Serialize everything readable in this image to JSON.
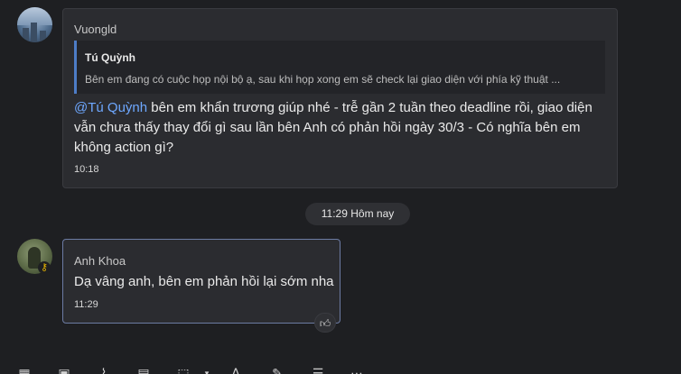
{
  "messages": [
    {
      "sender": "Vuongld",
      "quote": {
        "author": "Tú Quỳnh",
        "text": "Bên em đang có cuộc họp nội bộ ạ, sau khi họp xong em sẽ check lại giao diện với phía kỹ thuật ..."
      },
      "mention": "@Tú Quỳnh",
      "text": " bên em khẩn trương giúp nhé - trễ gần 2 tuần theo deadline rồi, giao diện vẫn chưa thấy thay đổi gì sau lần bên Anh có phản hồi ngày 30/3 - Có nghĩa bên em không action gì?",
      "time": "10:18"
    },
    {
      "sender": "Anh Khoa",
      "text": "Dạ vâng anh, bên em phản hồi lại sớm nha",
      "time": "11:29",
      "reaction_icon": "thumbs-up-icon"
    }
  ],
  "date_divider": "11:29 Hôm nay",
  "toolbar": {
    "icons": [
      "text-format-icon",
      "image-icon",
      "attach-icon",
      "gif-icon",
      "screenshot-icon",
      "font-icon",
      "edit-icon",
      "note-icon",
      "more-icon"
    ]
  }
}
